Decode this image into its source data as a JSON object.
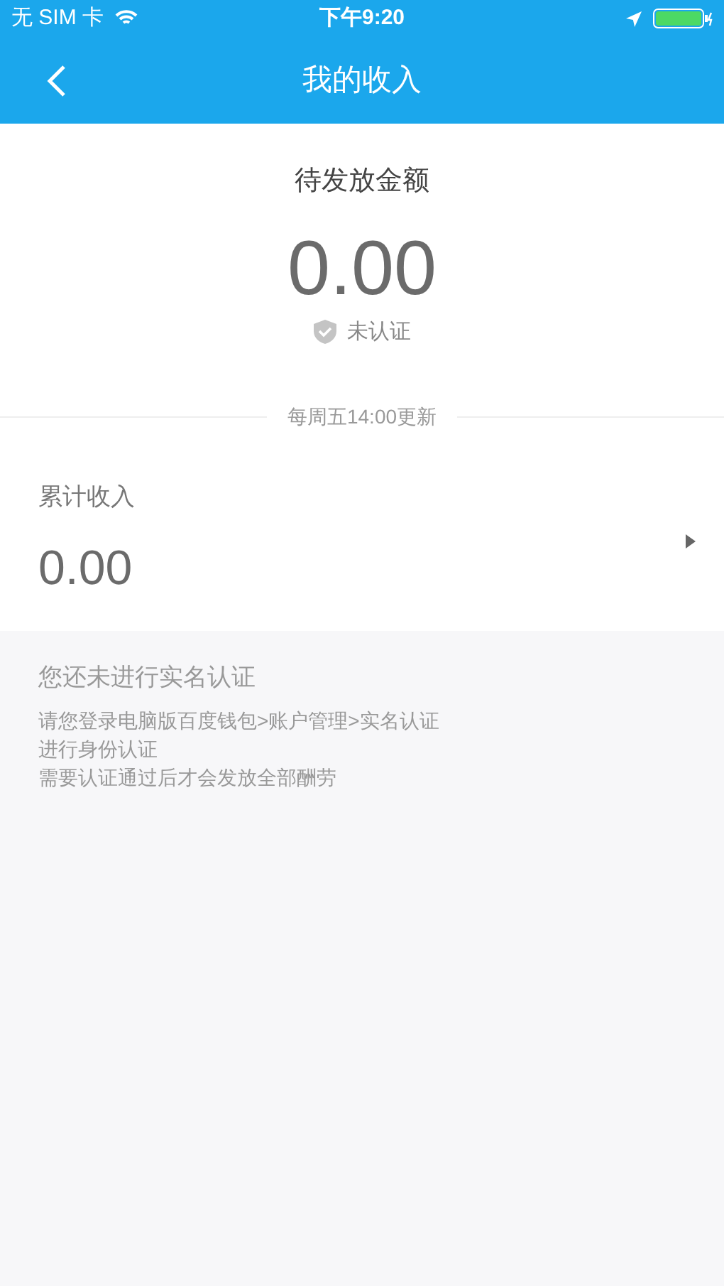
{
  "status_bar": {
    "carrier": "无 SIM 卡",
    "time": "下午9:20"
  },
  "nav": {
    "title": "我的收入"
  },
  "pending": {
    "label": "待发放金额",
    "amount": "0.00",
    "verification": "未认证"
  },
  "update_note": "每周五14:00更新",
  "total": {
    "label": "累计收入",
    "amount": "0.00"
  },
  "notice": {
    "title": "您还未进行实名认证",
    "lines": [
      "请您登录电脑版百度钱包>账户管理>实名认证",
      "进行身份认证",
      "需要认证通过后才会发放全部酬劳"
    ]
  }
}
